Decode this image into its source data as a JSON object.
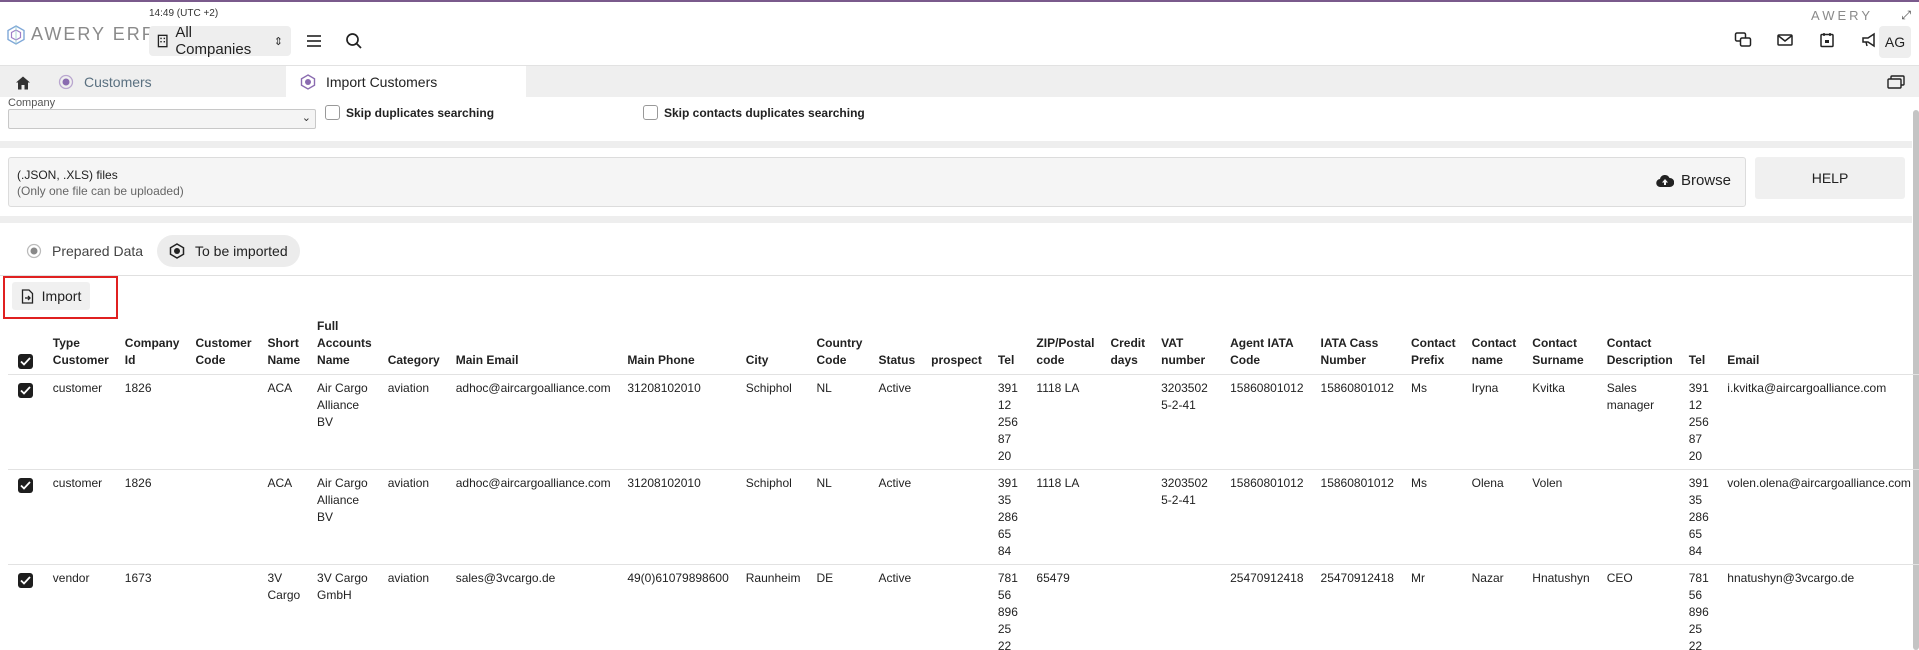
{
  "header": {
    "logo_text": "AWERY ERP",
    "clock": "14:49 (UTC +2)",
    "company_select": "All Companies",
    "brand_right": "AWERY",
    "avatar": "AG"
  },
  "tabs": {
    "customers": "Customers",
    "import_customers": "Import Customers"
  },
  "filters": {
    "company_label": "Company",
    "company_value": "",
    "skip_duplicates": "Skip duplicates searching",
    "skip_contacts_duplicates": "Skip contacts duplicates searching"
  },
  "upload": {
    "line1": "(.JSON, .XLS) files",
    "line2": "(Only one file can be uploaded)",
    "browse": "Browse",
    "help": "HELP"
  },
  "segments": {
    "prepared": "Prepared Data",
    "to_be_imported": "To be imported"
  },
  "import_button": "Import",
  "table": {
    "columns": [
      "Type Customer",
      "Company Id",
      "Customer Code",
      "Short Name",
      "Full Accounts Name",
      "Category",
      "Main Email",
      "Main Phone",
      "City",
      "Country Code",
      "Status",
      "prospect",
      "Tel",
      "ZIP/Postal code",
      "Credit days",
      "VAT number",
      "Agent IATA Code",
      "IATA Cass Number",
      "Contact Prefix",
      "Contact name",
      "Contact Surname",
      "Contact Description",
      "Tel",
      "Email"
    ],
    "rows": [
      {
        "type": "customer",
        "company_id": "1826",
        "customer_code": "",
        "short_name": "ACA",
        "full_name": "Air Cargo Alliance BV",
        "category": "aviation",
        "main_email": "adhoc@aircargoalliance.com",
        "main_phone": "31208102010",
        "city": "Schiphol",
        "country": "NL",
        "status": "Active",
        "prospect": "",
        "tel": "391 12 256 87 20",
        "zip": "1118 LA",
        "credit_days": "",
        "vat": "32035025-2-41",
        "agent_iata": "15860801012",
        "iata_cass": "15860801012",
        "prefix": "Ms",
        "contact_name": "Iryna",
        "contact_surname": "Kvitka",
        "contact_desc": "Sales manager",
        "tel2": "391 12 256 87 20",
        "email": "i.kvitka@aircargoalliance.com"
      },
      {
        "type": "customer",
        "company_id": "1826",
        "customer_code": "",
        "short_name": "ACA",
        "full_name": "Air Cargo Alliance BV",
        "category": "aviation",
        "main_email": "adhoc@aircargoalliance.com",
        "main_phone": "31208102010",
        "city": "Schiphol",
        "country": "NL",
        "status": "Active",
        "prospect": "",
        "tel": "391 35 286 65 84",
        "zip": "1118 LA",
        "credit_days": "",
        "vat": "32035025-2-41",
        "agent_iata": "15860801012",
        "iata_cass": "15860801012",
        "prefix": "Ms",
        "contact_name": "Olena",
        "contact_surname": "Volen",
        "contact_desc": "",
        "tel2": "391 35 286 65 84",
        "email": "volen.olena@aircargoalliance.com"
      },
      {
        "type": "vendor",
        "company_id": "1673",
        "customer_code": "",
        "short_name": "3V Cargo",
        "full_name": "3V Cargo GmbH",
        "category": "aviation",
        "main_email": "sales@3vcargo.de",
        "main_phone": "49(0)61079898600",
        "city": "Raunheim",
        "country": "DE",
        "status": "Active",
        "prospect": "",
        "tel": "781 56 896 25 22",
        "zip": "65479",
        "credit_days": "",
        "vat": "",
        "agent_iata": "25470912418",
        "iata_cass": "25470912418",
        "prefix": "Mr",
        "contact_name": "Nazar",
        "contact_surname": "Hnatushyn",
        "contact_desc": "CEO",
        "tel2": "781 56 896 25 22",
        "email": "hnatushyn@3vcargo.de"
      }
    ]
  },
  "colors": {
    "accent": "#7a5a8c",
    "highlight_box": "#e02020",
    "checkbox_checked": "#1e1e1e"
  }
}
